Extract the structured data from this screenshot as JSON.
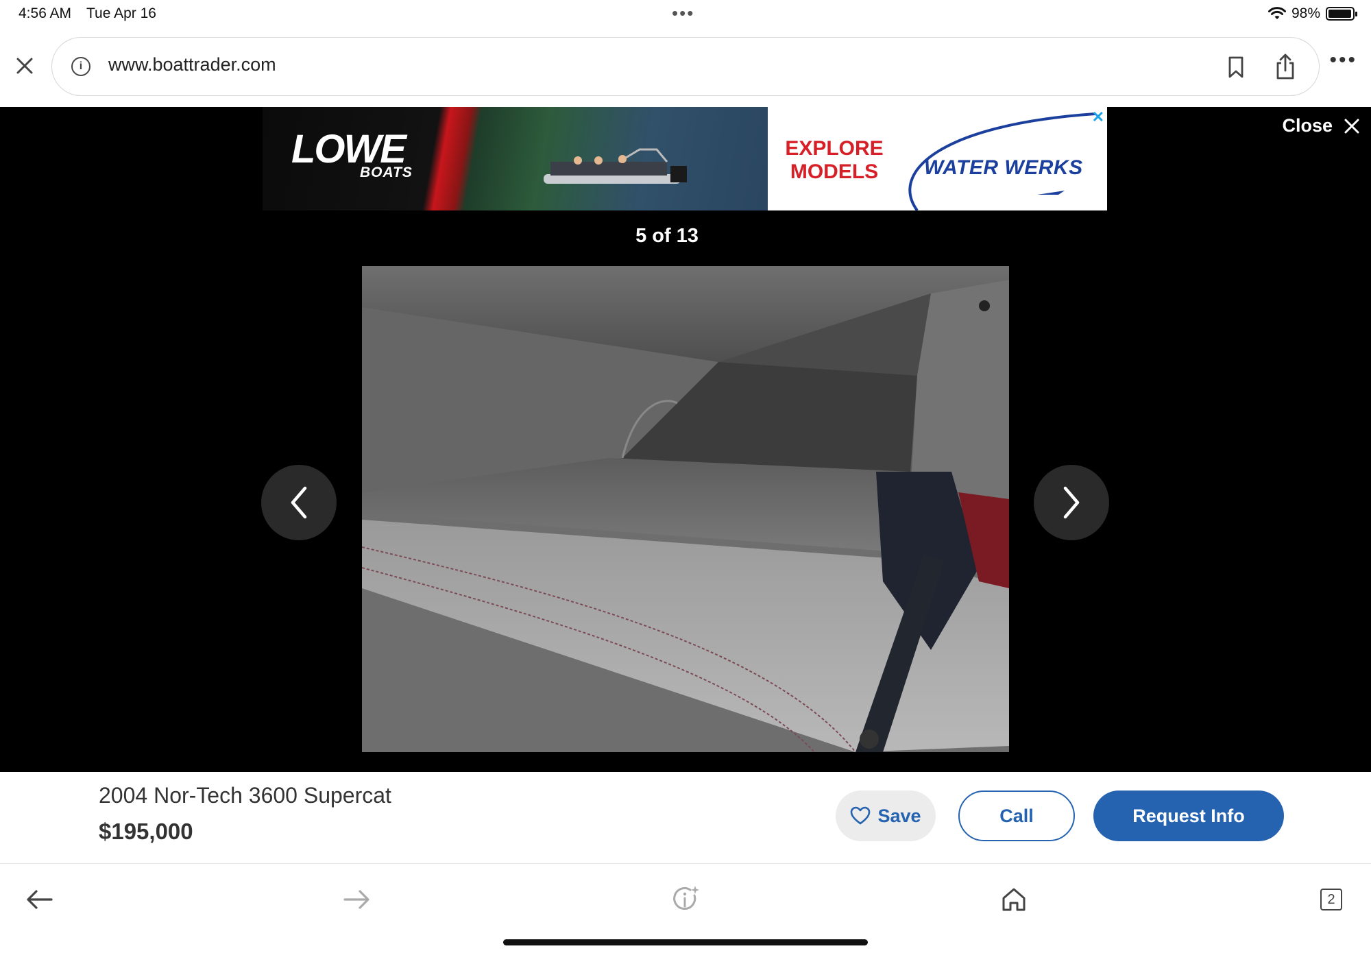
{
  "status_bar": {
    "time": "4:56 AM",
    "date": "Tue Apr 16",
    "battery": "98%",
    "battery_level": 0.98
  },
  "browser": {
    "url": "www.boattrader.com"
  },
  "ad": {
    "logo": "LOWE",
    "logo_sub": "BOATS",
    "cta_line1": "EXPLORE",
    "cta_line2": "MODELS",
    "brand": "WATER WERKS",
    "close": "✕"
  },
  "gallery": {
    "close_label": "Close",
    "counter": "5 of 13",
    "current": 5,
    "total": 13
  },
  "listing": {
    "title": "2004 Nor-Tech 3600 Supercat",
    "price": "$195,000",
    "save_label": "Save",
    "call_label": "Call",
    "request_label": "Request Info"
  },
  "toolbar": {
    "tabs_count": "2"
  },
  "colors": {
    "accent": "#2563b0",
    "ad_red": "#d61f26",
    "ad_blue": "#1b3f9c"
  }
}
